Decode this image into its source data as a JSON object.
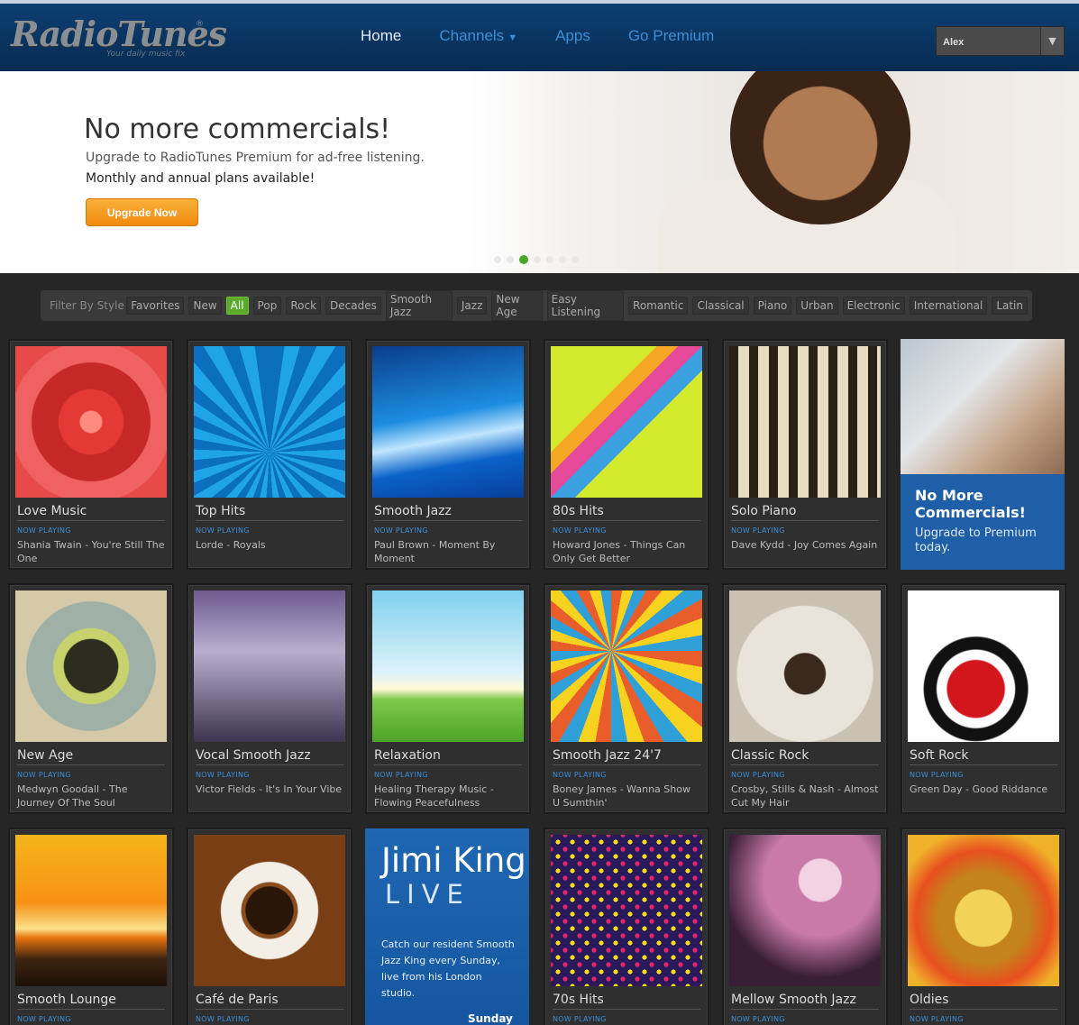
{
  "header": {
    "logo": "RadioTunes",
    "tagline": "Your daily music fix",
    "nav": [
      "Home",
      "Channels",
      "Apps",
      "Go Premium"
    ],
    "user": "Alex"
  },
  "hero": {
    "title": "No more commercials!",
    "subtitle": "Upgrade to RadioTunes Premium for ad-free listening.",
    "subtitle2": "Monthly and annual plans available!",
    "button": "Upgrade Now"
  },
  "filter": {
    "label": "Filter By Style",
    "items": [
      "Favorites",
      "New",
      "All",
      "Pop",
      "Rock",
      "Decades",
      "Smooth Jazz",
      "Jazz",
      "New Age",
      "Easy Listening",
      "Romantic",
      "Classical",
      "Piano",
      "Urban",
      "Electronic",
      "International",
      "Latin"
    ],
    "active": "All"
  },
  "now_playing_label": "NOW PLAYING",
  "channels": [
    {
      "name": "Love Music",
      "track": "Shania Twain - You're Still The One",
      "art": "rose",
      "color": "#d8302f"
    },
    {
      "name": "Top Hits",
      "track": "Lorde - Royals",
      "art": "burst",
      "color": "#1d8fd6"
    },
    {
      "name": "Smooth Jazz",
      "track": "Paul Brown - Moment By Moment",
      "art": "wave",
      "color": "#0a5fc0"
    },
    {
      "name": "80s Hits",
      "track": "Howard Jones - Things Can Only Get Better",
      "art": "cassette",
      "color": "#c6e13a"
    },
    {
      "name": "Solo Piano",
      "track": "Dave Kydd - Joy Comes Again",
      "art": "piano",
      "color": "#b69d6c"
    },
    {
      "name": "New Age",
      "track": "Medwyn Goodall - The Journey Of The Soul",
      "art": "butterfly",
      "color": "#8ea58f"
    },
    {
      "name": "Vocal Smooth Jazz",
      "track": "Victor Fields - It's In Your Vibe",
      "art": "singer",
      "color": "#7d6fa0"
    },
    {
      "name": "Relaxation",
      "track": "Healing Therapy Music - Flowing Peacefulness",
      "art": "meadow",
      "color": "#7ec86c"
    },
    {
      "name": "Smooth Jazz 24'7",
      "track": "Boney James - Wanna Show U Sumthin'",
      "art": "sax",
      "color": "#e56a28"
    },
    {
      "name": "Classic Rock",
      "track": "Crosby, Stills & Nash - Almost Cut My Hair",
      "art": "guitar",
      "color": "#cfcac0"
    },
    {
      "name": "Soft Rock",
      "track": "Green Day - Good Riddance",
      "art": "heart",
      "color": "#d22b2b"
    },
    {
      "name": "Smooth Lounge",
      "track": "",
      "art": "sunset",
      "color": "#f29a16"
    },
    {
      "name": "Café de Paris",
      "track": "",
      "art": "coffee",
      "color": "#a6612e"
    },
    {
      "name": "70s Hits",
      "track": "",
      "art": "dots",
      "color": "#3a2a6b"
    },
    {
      "name": "Mellow Smooth Jazz",
      "track": "",
      "art": "mellow",
      "color": "#9c4e86"
    },
    {
      "name": "Oldies",
      "track": "",
      "art": "jukebox",
      "color": "#d6921f"
    }
  ],
  "promo": {
    "title": "No More Commercials!",
    "subtitle": "Upgrade to Premium today."
  },
  "jimi": {
    "title": "Jimi King",
    "live": "LIVE",
    "text": "Catch our resident Smooth Jazz King every Sunday, live from his London studio.",
    "day": "Sunday"
  }
}
